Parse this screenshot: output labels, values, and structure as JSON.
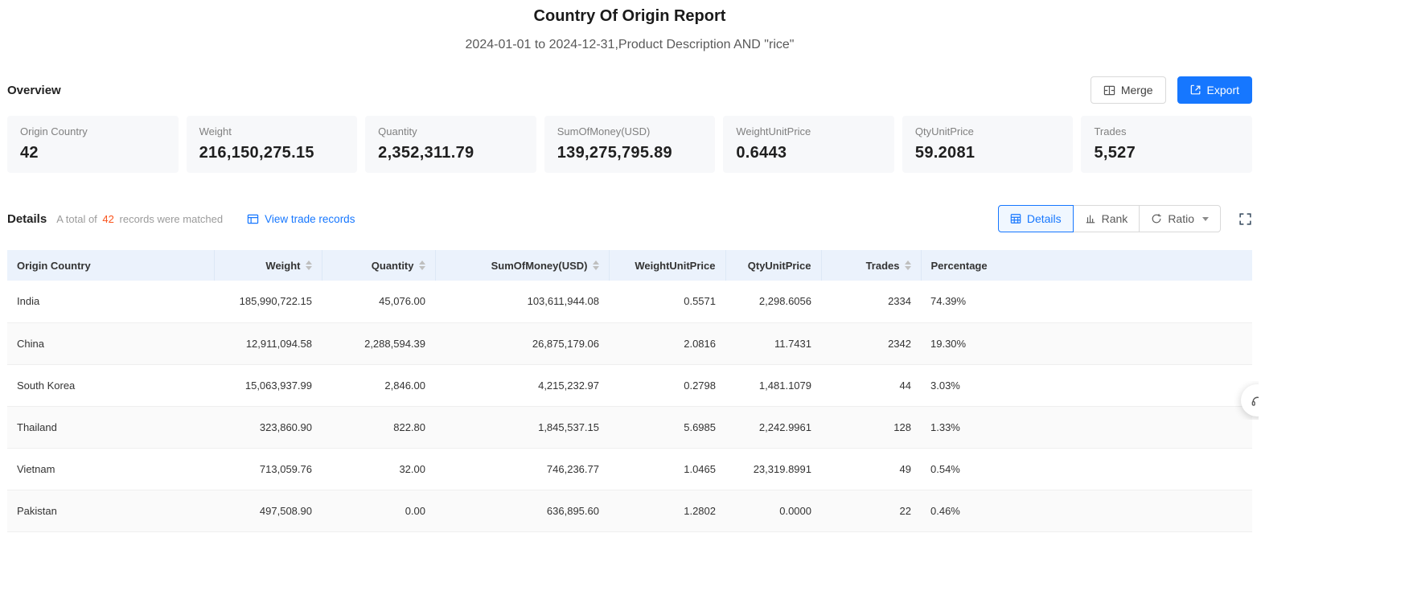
{
  "report": {
    "title": "Country Of Origin Report",
    "subtitle": "2024-01-01 to 2024-12-31,Product Description AND \"rice\""
  },
  "overview": {
    "heading": "Overview",
    "merge_label": "Merge",
    "export_label": "Export",
    "cards": [
      {
        "label": "Origin Country",
        "value": "42"
      },
      {
        "label": "Weight",
        "value": "216,150,275.15"
      },
      {
        "label": "Quantity",
        "value": "2,352,311.79"
      },
      {
        "label": "SumOfMoney(USD)",
        "value": "139,275,795.89"
      },
      {
        "label": "WeightUnitPrice",
        "value": "0.6443"
      },
      {
        "label": "QtyUnitPrice",
        "value": "59.2081"
      },
      {
        "label": "Trades",
        "value": "5,527"
      }
    ]
  },
  "details": {
    "heading": "Details",
    "matched_prefix": "A total of",
    "matched_count": "42",
    "matched_suffix": "records were matched",
    "view_link": "View trade records",
    "tabs": [
      {
        "label": "Details",
        "active": true
      },
      {
        "label": "Rank",
        "active": false
      },
      {
        "label": "Ratio",
        "active": false,
        "has_dropdown": true
      }
    ]
  },
  "table": {
    "columns": [
      {
        "label": "Origin Country",
        "sortable": false
      },
      {
        "label": "Weight",
        "sortable": true
      },
      {
        "label": "Quantity",
        "sortable": true
      },
      {
        "label": "SumOfMoney(USD)",
        "sortable": true
      },
      {
        "label": "WeightUnitPrice",
        "sortable": false
      },
      {
        "label": "QtyUnitPrice",
        "sortable": false
      },
      {
        "label": "Trades",
        "sortable": true
      },
      {
        "label": "Percentage",
        "sortable": false
      }
    ],
    "rows": [
      [
        "India",
        "185,990,722.15",
        "45,076.00",
        "103,611,944.08",
        "0.5571",
        "2,298.6056",
        "2334",
        "74.39%"
      ],
      [
        "China",
        "12,911,094.58",
        "2,288,594.39",
        "26,875,179.06",
        "2.0816",
        "11.7431",
        "2342",
        "19.30%"
      ],
      [
        "South Korea",
        "15,063,937.99",
        "2,846.00",
        "4,215,232.97",
        "0.2798",
        "1,481.1079",
        "44",
        "3.03%"
      ],
      [
        "Thailand",
        "323,860.90",
        "822.80",
        "1,845,537.15",
        "5.6985",
        "2,242.9961",
        "128",
        "1.33%"
      ],
      [
        "Vietnam",
        "713,059.76",
        "32.00",
        "746,236.77",
        "1.0465",
        "23,319.8991",
        "49",
        "0.54%"
      ],
      [
        "Pakistan",
        "497,508.90",
        "0.00",
        "636,895.60",
        "1.2802",
        "0.0000",
        "22",
        "0.46%"
      ]
    ]
  },
  "icons": {
    "merge_button": "merge-cells-icon",
    "export_button": "export-icon",
    "view_link": "records-table-icon",
    "tab_details": "table-icon",
    "tab_rank": "bar-chart-icon",
    "tab_ratio": "cycle-icon",
    "fullscreen": "expand-icon",
    "support": "headset-icon",
    "sort": "sort-carets-icon"
  },
  "colors": {
    "accent": "#1677ff",
    "highlight_count": "#fa541c",
    "table_header_bg": "#ebf2fc",
    "card_bg": "#f7f8fa",
    "row_alt_bg": "#fafafa"
  }
}
